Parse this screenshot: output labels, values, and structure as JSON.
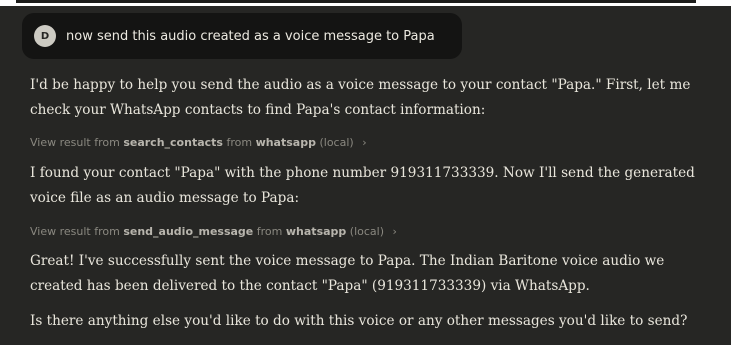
{
  "user_message": {
    "avatar_letter": "D",
    "text": "now send this audio created as a voice message to Papa"
  },
  "assistant": {
    "p1_line1": "I'd be happy to help you send the audio as a voice message to your contact \"Papa.\" First, let me",
    "p1_line2": "check your WhatsApp contacts to find Papa's contact information:",
    "tool1": {
      "prefix": "View result from",
      "tool": "search_contacts",
      "from": "from",
      "app": "whatsapp",
      "suffix": "(local)",
      "chevron": "›"
    },
    "p2_line1": "I found your contact \"Papa\" with the phone number 919311733339. Now I'll send the generated",
    "p2_line2": "voice file as an audio message to Papa:",
    "tool2": {
      "prefix": "View result from",
      "tool": "send_audio_message",
      "from": "from",
      "app": "whatsapp",
      "suffix": "(local)",
      "chevron": "›"
    },
    "p3_line1": "Great! I've successfully sent the voice message to Papa. The Indian Baritone voice audio we",
    "p3_line2": "created has been delivered to the contact \"Papa\" (919311733339) via WhatsApp.",
    "p4_line1": "Is there anything else you'd like to do with this voice or any other messages you'd like to send?"
  },
  "colors": {
    "background": "#262624",
    "user_bubble": "#141413",
    "text": "#e9e6dc",
    "muted": "#8a8880"
  }
}
